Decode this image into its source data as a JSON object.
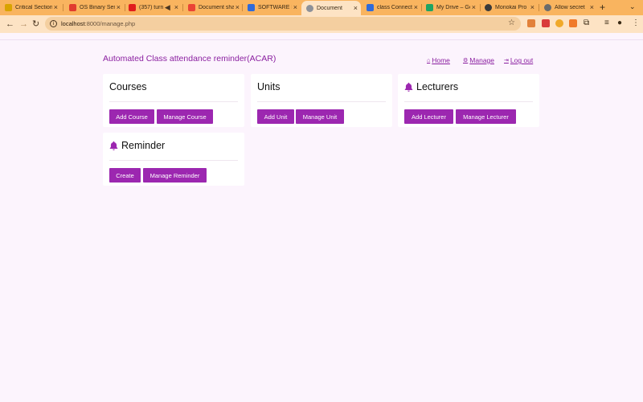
{
  "browser": {
    "tabs": [
      {
        "title": "Critical Section",
        "favicon_color": "#d9a300"
      },
      {
        "title": "OS Binary Sem",
        "favicon_color": "#e03b2f"
      },
      {
        "title": "(357) turn",
        "favicon_color": "#e01d1d",
        "muted": "◀×"
      },
      {
        "title": "Document sha",
        "favicon_color": "#ea4335"
      },
      {
        "title": "SOFTWARE DE",
        "favicon_color": "#2f6ad9"
      },
      {
        "title": "Document",
        "favicon_color": "#8d9199"
      },
      {
        "title": "class Connect",
        "favicon_color": "#2f6ad9"
      },
      {
        "title": "My Drive – Go",
        "favicon_color": "#1fa463"
      },
      {
        "title": "Monokai Pro",
        "favicon_color": "#3a3a3a"
      },
      {
        "title": "Allow secret",
        "favicon_color": "#6b6b6b"
      }
    ],
    "new_tab": "+",
    "tab_menu": "⌄",
    "url_host": "localhost",
    "url_path": ":8000/manage.php",
    "info_icon": "i",
    "star_icon": "☆",
    "back": "←",
    "forward": "→",
    "reload": "↻"
  },
  "header": {
    "brand": "Automated Class attendance reminder(ACAR)",
    "nav": {
      "home": "Home",
      "manage": "Manage",
      "logout": "Log out"
    }
  },
  "cards": {
    "courses": {
      "title": "Courses",
      "buttons": [
        "Add Course",
        "Manage Course"
      ]
    },
    "units": {
      "title": "Units",
      "buttons": [
        "Add Unit",
        "Manage Unit"
      ]
    },
    "lecturers": {
      "title": "Lecturers",
      "buttons": [
        "Add Lecturer",
        "Manage Lecturer"
      ]
    },
    "reminder": {
      "title": "Reminder",
      "buttons": [
        "Create",
        "Manage Reminder"
      ]
    }
  },
  "colors": {
    "accent": "#9c27b0",
    "brand_text": "#8a1fa0",
    "page_bg": "#fcf4fd",
    "tabbar": "#f9b45f"
  }
}
